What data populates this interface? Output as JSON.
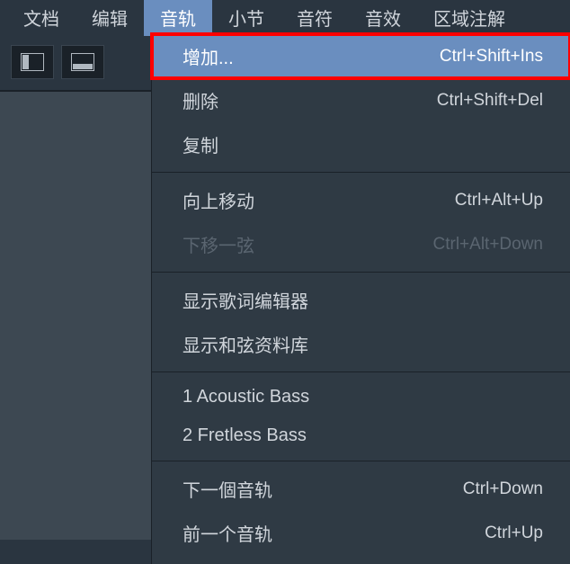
{
  "menubar": {
    "items": [
      {
        "label": "文档"
      },
      {
        "label": "编辑"
      },
      {
        "label": "音轨"
      },
      {
        "label": "小节"
      },
      {
        "label": "音符"
      },
      {
        "label": "音效"
      },
      {
        "label": "区域注解"
      }
    ],
    "active_index": 2
  },
  "dropdown": {
    "groups": [
      [
        {
          "label": "增加...",
          "shortcut": "Ctrl+Shift+Ins",
          "highlighted": true,
          "disabled": false
        },
        {
          "label": "删除",
          "shortcut": "Ctrl+Shift+Del",
          "highlighted": false,
          "disabled": false
        },
        {
          "label": "复制",
          "shortcut": "",
          "highlighted": false,
          "disabled": false
        }
      ],
      [
        {
          "label": "向上移动",
          "shortcut": "Ctrl+Alt+Up",
          "highlighted": false,
          "disabled": false
        },
        {
          "label": "下移一弦",
          "shortcut": "Ctrl+Alt+Down",
          "highlighted": false,
          "disabled": true
        }
      ],
      [
        {
          "label": "显示歌词编辑器",
          "shortcut": "",
          "highlighted": false,
          "disabled": false
        },
        {
          "label": "显示和弦资料库",
          "shortcut": "",
          "highlighted": false,
          "disabled": false
        }
      ],
      [
        {
          "label": "1 Acoustic Bass",
          "shortcut": "",
          "highlighted": false,
          "disabled": false
        },
        {
          "label": "2 Fretless Bass",
          "shortcut": "",
          "highlighted": false,
          "disabled": false
        }
      ],
      [
        {
          "label": "下一個音轨",
          "shortcut": "Ctrl+Down",
          "highlighted": false,
          "disabled": false
        },
        {
          "label": "前一个音轨",
          "shortcut": "Ctrl+Up",
          "highlighted": false,
          "disabled": false
        }
      ]
    ]
  }
}
